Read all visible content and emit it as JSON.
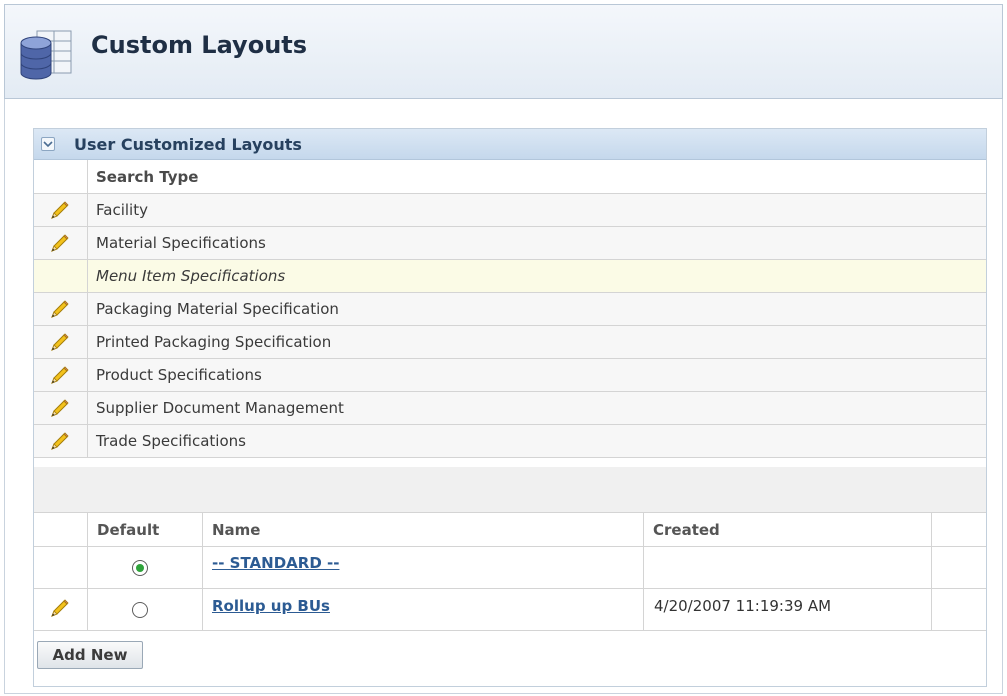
{
  "header": {
    "title": "Custom Layouts",
    "icon": "database-table-icon"
  },
  "panel": {
    "title": "User Customized Layouts",
    "search_type_header": "Search Type",
    "rows": [
      {
        "label": "Facility",
        "editable": true,
        "italic": false
      },
      {
        "label": "Material Specifications",
        "editable": true,
        "italic": false
      },
      {
        "label": "Menu Item Specifications",
        "editable": false,
        "italic": true
      },
      {
        "label": "Packaging Material Specification",
        "editable": true,
        "italic": false
      },
      {
        "label": "Printed Packaging Specification",
        "editable": true,
        "italic": false
      },
      {
        "label": "Product Specifications",
        "editable": true,
        "italic": false
      },
      {
        "label": "Supplier Document Management",
        "editable": true,
        "italic": false
      },
      {
        "label": "Trade Specifications",
        "editable": true,
        "italic": false
      }
    ]
  },
  "layouts": {
    "headers": {
      "default": "Default",
      "name": "Name",
      "created": "Created"
    },
    "rows": [
      {
        "name": "-- STANDARD --",
        "created": "",
        "selected": true,
        "editable": false
      },
      {
        "name": "Rollup up BUs",
        "created": "4/20/2007 11:19:39 AM",
        "selected": false,
        "editable": true
      }
    ]
  },
  "buttons": {
    "add_new": "Add New"
  },
  "colors": {
    "radio_selected": "#2fa33b",
    "link": "#2c5b93",
    "highlight_row": "#fbfbe6"
  }
}
